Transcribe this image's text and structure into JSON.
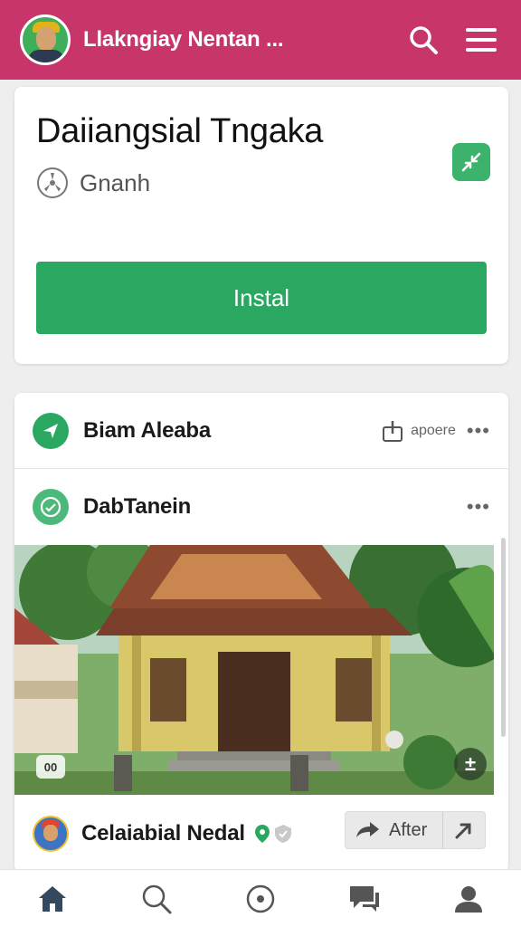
{
  "header": {
    "title": "Llakngiay Nentan ...",
    "search_icon": "search-icon",
    "menu_icon": "hamburger-menu-icon",
    "color": "#c8356b"
  },
  "app_card": {
    "title": "Daiiangsial Tngaka",
    "subtitle": "Gnanh",
    "subtitle_icon": "fan-icon",
    "badge_icon": "share-icon",
    "install_label": "Instal",
    "install_color": "#2aa862"
  },
  "feed_card": {
    "row1": {
      "title": "Biam Aleaba",
      "meta": "apoere",
      "icon": "send-icon"
    },
    "row2": {
      "title": "DabTanein",
      "icon": "refresh-icon"
    },
    "photo": {
      "counter": "00",
      "add_label": "±"
    },
    "author": {
      "name": "Celaiabial Nedal",
      "action_label": "After"
    }
  },
  "bottom_nav": {
    "items": [
      "home-icon",
      "search-icon",
      "compass-icon",
      "chat-icon",
      "profile-icon"
    ]
  }
}
